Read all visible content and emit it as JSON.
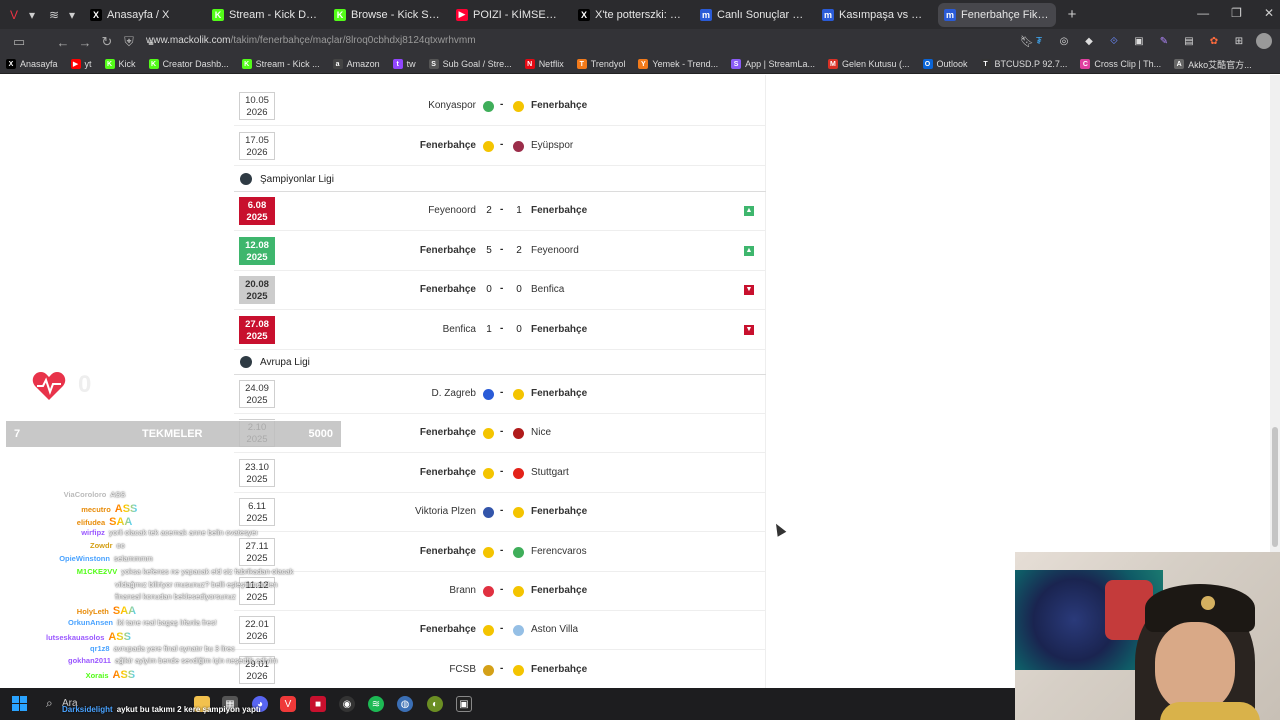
{
  "browser": {
    "tabs": [
      {
        "label": "Anasayfa / X",
        "color": "#000000",
        "glyph": "X",
        "active": false
      },
      {
        "label": "Stream - Kick Dashboard",
        "color": "#53fc18",
        "glyph": "K",
        "active": false
      },
      {
        "label": "Browse - Kick Streaming",
        "color": "#53fc18",
        "glyph": "K",
        "active": false
      },
      {
        "label": "POIZI - KİMSELER DUYMAS",
        "color": "#ff0033",
        "glyph": "▶",
        "active": false
      },
      {
        "label": "X'te potterszki: \"fenerliler...",
        "color": "#000000",
        "glyph": "X",
        "active": false
      },
      {
        "label": "Canlı Sonuçlar - İddaa Sonu",
        "color": "#2a5bd7",
        "glyph": "m",
        "active": false
      },
      {
        "label": "Kasımpaşa vs Fenerbahçe",
        "color": "#2a5bd7",
        "glyph": "m",
        "active": false
      },
      {
        "label": "Fenerbahçe Fikstür | Macko",
        "color": "#2a5bd7",
        "glyph": "m",
        "active": true
      }
    ],
    "url_domain": "www.mackolik.com",
    "url_path": "/takim/fenerbahçe/maçlar/8lroq0cbhdxj8124qtxwrhvmm",
    "bookmarks": [
      {
        "label": "Anasayfa",
        "color": "#000000",
        "glyph": "X"
      },
      {
        "label": "yt",
        "color": "#ff0000",
        "glyph": "▶"
      },
      {
        "label": "Kick",
        "color": "#53fc18",
        "glyph": "K"
      },
      {
        "label": "Creator Dashb...",
        "color": "#53fc18",
        "glyph": "K"
      },
      {
        "label": "Stream - Kick ...",
        "color": "#53fc18",
        "glyph": "K"
      },
      {
        "label": "Amazon",
        "color": "#444444",
        "glyph": "a"
      },
      {
        "label": "tw",
        "color": "#9146ff",
        "glyph": "t"
      },
      {
        "label": "Sub Goal / Stre...",
        "color": "#555555",
        "glyph": "S"
      },
      {
        "label": "Netflix",
        "color": "#e50914",
        "glyph": "N"
      },
      {
        "label": "Trendyol",
        "color": "#f27a1a",
        "glyph": "T"
      },
      {
        "label": "Yemek - Trend...",
        "color": "#f27a1a",
        "glyph": "Y"
      },
      {
        "label": "App | StreamLa...",
        "color": "#8a5cf6",
        "glyph": "S"
      },
      {
        "label": "Gelen Kutusu (...",
        "color": "#d93025",
        "glyph": "M"
      },
      {
        "label": "Outlook",
        "color": "#0a64d6",
        "glyph": "O"
      },
      {
        "label": "BTCUSD.P 92.7...",
        "color": "#333333",
        "glyph": "T"
      },
      {
        "label": "Cross Clip | Th...",
        "color": "#e040a0",
        "glyph": "C"
      },
      {
        "label": "Akko艾酷官方...",
        "color": "#666666",
        "glyph": "A"
      }
    ]
  },
  "fixtures": {
    "top_rows": [
      {
        "date_top": "10.05",
        "date_bottom": "2026",
        "home": "Konyaspor",
        "away": "Fenerbahçe",
        "home_bold": false,
        "away_bold": true,
        "home_logo": "#3fae5a",
        "away_logo": "#f4c400"
      },
      {
        "date_top": "17.05",
        "date_bottom": "2026",
        "home": "Fenerbahçe",
        "away": "Eyüpspor",
        "home_bold": true,
        "away_bold": false,
        "home_logo": "#f4c400",
        "away_logo": "#9b2d4a"
      }
    ],
    "league1": "Şampiyonlar Ligi",
    "cl_rows": [
      {
        "date_top": "6.08",
        "date_bottom": "2025",
        "result": "loss",
        "home": "Feyenoord",
        "away": "Fenerbahçe",
        "home_score": "2",
        "away_score": "1",
        "home_bold": false,
        "away_bold": true,
        "arrow": "up"
      },
      {
        "date_top": "12.08",
        "date_bottom": "2025",
        "result": "win",
        "home": "Fenerbahçe",
        "away": "Feyenoord",
        "home_score": "5",
        "away_score": "2",
        "home_bold": true,
        "away_bold": false,
        "arrow": "up"
      },
      {
        "date_top": "20.08",
        "date_bottom": "2025",
        "result": "draw",
        "home": "Fenerbahçe",
        "away": "Benfica",
        "home_score": "0",
        "away_score": "0",
        "home_bold": true,
        "away_bold": false,
        "arrow": "down"
      },
      {
        "date_top": "27.08",
        "date_bottom": "2025",
        "result": "loss",
        "home": "Benfica",
        "away": "Fenerbahçe",
        "home_score": "1",
        "away_score": "0",
        "home_bold": false,
        "away_bold": true,
        "arrow": "down"
      }
    ],
    "league2": "Avrupa Ligi",
    "el_rows": [
      {
        "date_top": "24.09",
        "date_bottom": "2025",
        "home": "D. Zagreb",
        "away": "Fenerbahçe",
        "home_bold": false,
        "away_bold": true,
        "home_logo": "#2a5bd7",
        "away_logo": "#f4c400"
      },
      {
        "date_top": "2.10",
        "date_bottom": "2025",
        "home": "Fenerbahçe",
        "away": "Nice",
        "home_bold": true,
        "away_bold": false,
        "home_logo": "#f4c400",
        "away_logo": "#b01b1b"
      },
      {
        "date_top": "23.10",
        "date_bottom": "2025",
        "home": "Fenerbahçe",
        "away": "Stuttgart",
        "home_bold": true,
        "away_bold": false,
        "home_logo": "#f4c400",
        "away_logo": "#e32219"
      },
      {
        "date_top": "6.11",
        "date_bottom": "2025",
        "home": "Viktoria Plzen",
        "away": "Fenerbahçe",
        "home_bold": false,
        "away_bold": true,
        "home_logo": "#3355aa",
        "away_logo": "#f4c400"
      },
      {
        "date_top": "27.11",
        "date_bottom": "2025",
        "home": "Fenerbahçe",
        "away": "Ferencvaros",
        "home_bold": true,
        "away_bold": false,
        "home_logo": "#f4c400",
        "away_logo": "#3fae5a"
      },
      {
        "date_top": "11.12",
        "date_bottom": "2025",
        "home": "Brann",
        "away": "Fenerbahçe",
        "home_bold": false,
        "away_bold": true,
        "home_logo": "#e03040",
        "away_logo": "#f4c400"
      },
      {
        "date_top": "22.01",
        "date_bottom": "2026",
        "home": "Fenerbahçe",
        "away": "Aston Villa",
        "home_bold": true,
        "away_bold": false,
        "home_logo": "#f4c400",
        "away_logo": "#95bfe5"
      },
      {
        "date_top": "29.01",
        "date_bottom": "2026",
        "home": "FCSB",
        "away": "Fenerbahçe",
        "home_bold": false,
        "away_bold": true,
        "home_logo": "#d4a017",
        "away_logo": "#f4c400"
      }
    ]
  },
  "overlay": {
    "heart_count": "0",
    "kick_left": "7",
    "kick_label": "TEKMELER",
    "kick_right": "5000",
    "chat": [
      {
        "user": "ViaCoroloro",
        "msg": "ASS",
        "ucolor": "#bbbbbb",
        "emote": false
      },
      {
        "user": "mecutro",
        "msg": "ASS",
        "ucolor": "#e88c0a",
        "emote": true
      },
      {
        "user": "elifudea",
        "msg": "SAA",
        "ucolor": "#e88c0a",
        "emote": true
      },
      {
        "user": "wirfipz",
        "msg": "yorli olacak tek acemak anne belin ovatesyeı",
        "ucolor": "#9b59ff",
        "emote": false
      },
      {
        "user": "Zowdr",
        "msg": "oo",
        "ucolor": "#d4a017",
        "emote": false
      },
      {
        "user": "OpieWinstonn",
        "msg": "selammmm",
        "ucolor": "#4aa3ff",
        "emote": false
      },
      {
        "user": "M1CKE2VV",
        "msg": "yoksa kefenss ne yapacak eld siz fabrikadan olacak",
        "ucolor": "#53fc18",
        "emote": false
      },
      {
        "user": "",
        "msg": "vildağmız biliriyor musunuz? belli eşleştirmenden",
        "ucolor": "#ffffff",
        "emote": false
      },
      {
        "user": "",
        "msg": "finansal konudan beklesediyorsunuz",
        "ucolor": "#ffffff",
        "emote": false
      },
      {
        "user": "HolyLeth",
        "msg": "SAA",
        "ucolor": "#e88c0a",
        "emote": true
      },
      {
        "user": "OrkunAnsen",
        "msg": "iki tane real bagaş lıfanla fres!",
        "ucolor": "#4aa3ff",
        "emote": false
      },
      {
        "user": "lutseskauasolos",
        "msg": "ASS",
        "ucolor": "#9b59ff",
        "emote": true
      },
      {
        "user": "qr1z8",
        "msg": "avrupada yere final oynatır bu 3 lirec",
        "ucolor": "#4aa3ff",
        "emote": false
      },
      {
        "user": "gokhan2011",
        "msg": "ağikir ayiyim bende sevdiğim için neşedlik ediyim",
        "ucolor": "#9b59ff",
        "emote": false
      },
      {
        "user": "Xorais",
        "msg": "ASS",
        "ucolor": "#53fc18",
        "emote": true
      }
    ],
    "chat_bottom_user": "Darksidelight",
    "chat_bottom_msg": "aykut bu takımı 2 kere şampiyon yaptı"
  },
  "taskbar": {
    "search_label": "Ara"
  }
}
